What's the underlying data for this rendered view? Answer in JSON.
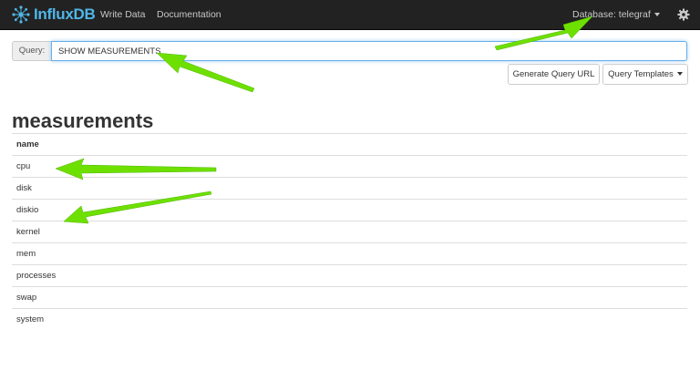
{
  "navbar": {
    "brand": "InfluxDB",
    "links": [
      "Write Data",
      "Documentation"
    ],
    "database_label": "Database: telegraf"
  },
  "query": {
    "addon_label": "Query:",
    "value": "SHOW MEASUREMENTS"
  },
  "buttons": {
    "generate_url": "Generate Query URL",
    "query_templates": "Query Templates"
  },
  "result": {
    "title": "measurements",
    "columns": [
      "name"
    ],
    "rows": [
      "cpu",
      "disk",
      "diskio",
      "kernel",
      "mem",
      "processes",
      "swap",
      "system"
    ]
  },
  "colors": {
    "navbar_bg": "#222222",
    "brand": "#4fb6e8",
    "annotation_arrow": "#6ee000"
  }
}
